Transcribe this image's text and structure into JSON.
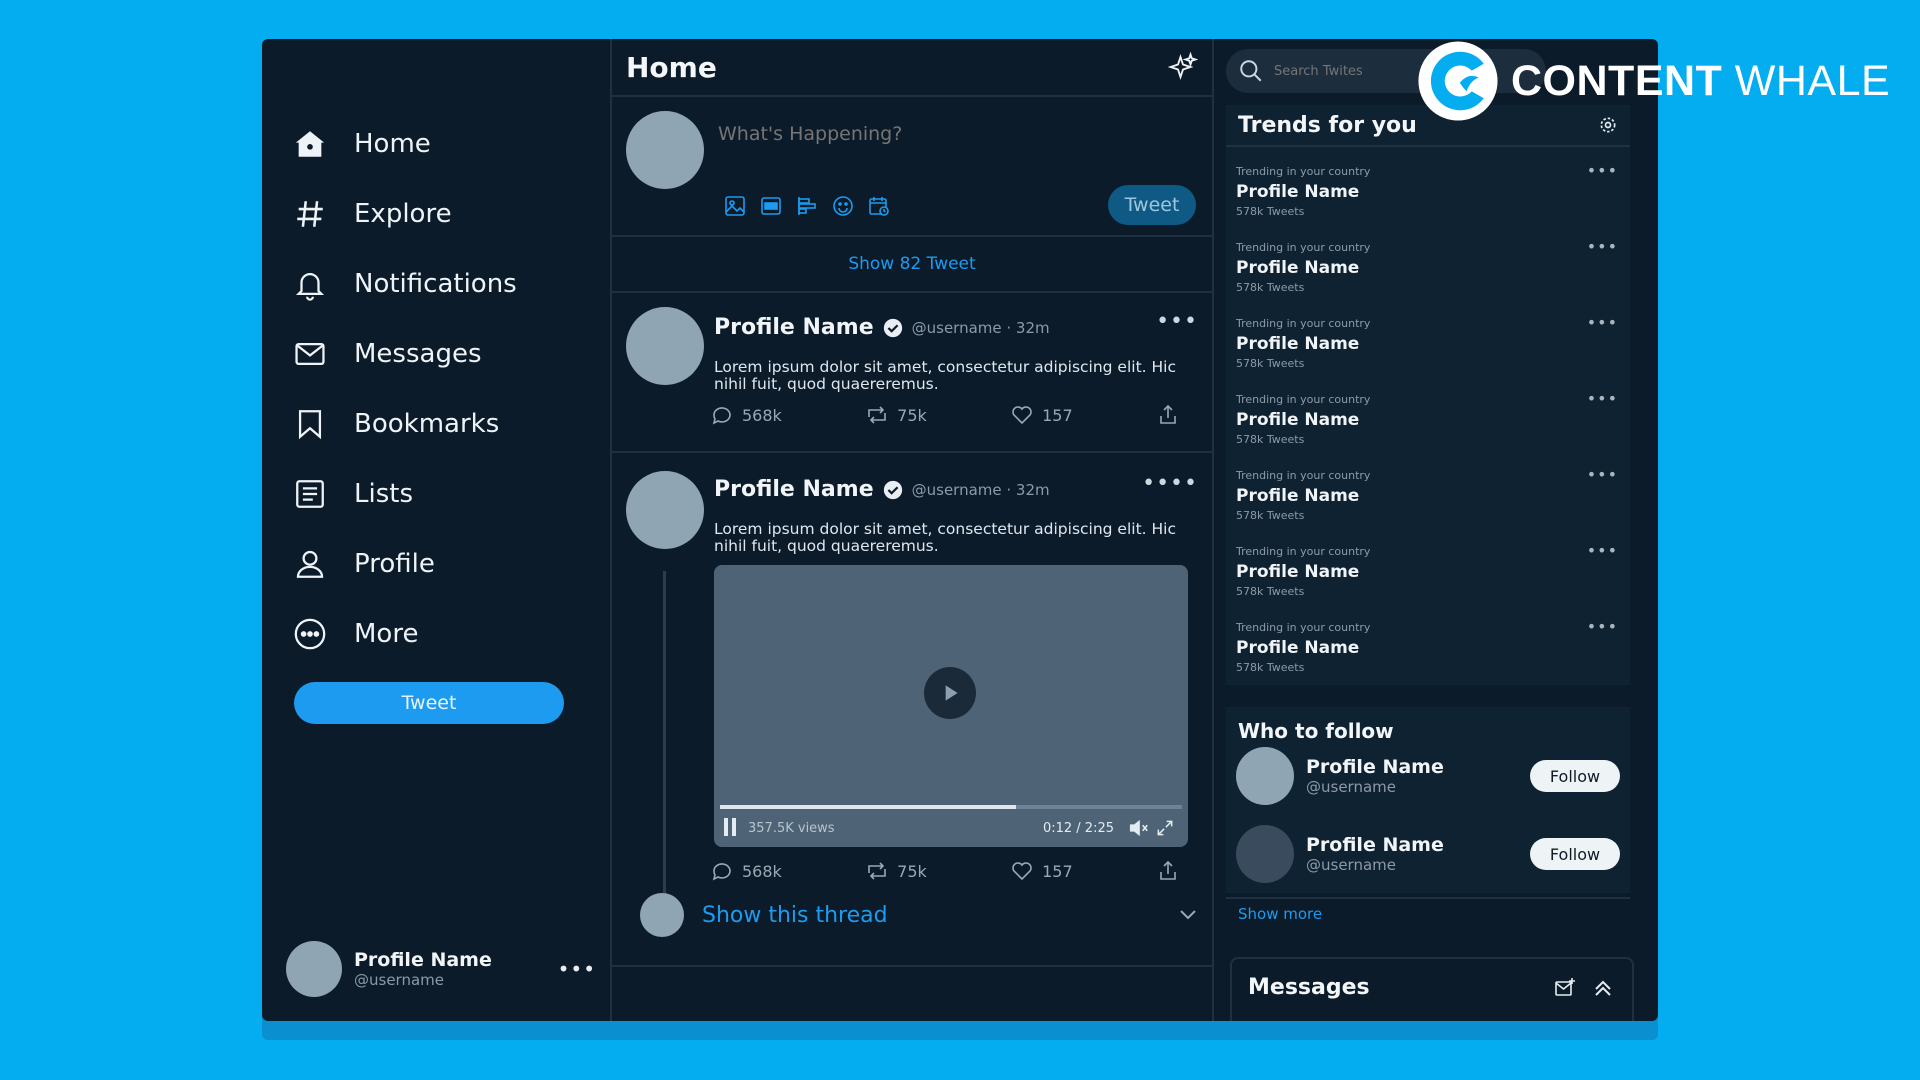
{
  "brand": {
    "name_bold": "CONTENT",
    "name_light": "WHALE"
  },
  "sidebar": {
    "items": [
      {
        "label": "Home",
        "icon": "home-icon"
      },
      {
        "label": "Explore",
        "icon": "hash-icon"
      },
      {
        "label": "Notifications",
        "icon": "bell-icon"
      },
      {
        "label": "Messages",
        "icon": "mail-icon"
      },
      {
        "label": "Bookmarks",
        "icon": "bookmark-icon"
      },
      {
        "label": "Lists",
        "icon": "list-icon"
      },
      {
        "label": "Profile",
        "icon": "user-icon"
      },
      {
        "label": "More",
        "icon": "more-circle-icon"
      }
    ],
    "tweet_button": "Tweet",
    "account": {
      "name": "Profile Name",
      "username": "@username"
    }
  },
  "feed": {
    "title": "Home",
    "compose": {
      "placeholder": "What's Happening?",
      "button": "Tweet"
    },
    "show_new": "Show 82 Tweet",
    "tweets": [
      {
        "name": "Profile Name",
        "meta": "@username · 32m",
        "text": "Lorem ipsum dolor sit amet, consectetur adipiscing elit. Hic nihil fuit, quod quaereremus.",
        "replies": "568k",
        "retweets": "75k",
        "likes": "157"
      },
      {
        "name": "Profile Name",
        "meta": "@username · 32m",
        "text": "Lorem ipsum dolor sit amet, consectetur adipiscing elit. Hic nihil fuit, quod quaereremus.",
        "replies": "568k",
        "retweets": "75k",
        "likes": "157",
        "video": {
          "views": "357.5K views",
          "time": "0:12 / 2:25",
          "progress": 0.64
        },
        "show_thread": "Show this thread"
      }
    ]
  },
  "right": {
    "search_placeholder": "Search Twites",
    "trends_title": "Trends for you",
    "trends": [
      {
        "category": "Trending in your country",
        "name": "Profile Name",
        "count": "578k Tweets"
      },
      {
        "category": "Trending in your country",
        "name": "Profile Name",
        "count": "578k Tweets"
      },
      {
        "category": "Trending in your country",
        "name": "Profile Name",
        "count": "578k Tweets"
      },
      {
        "category": "Trending in your country",
        "name": "Profile Name",
        "count": "578k Tweets"
      },
      {
        "category": "Trending in your country",
        "name": "Profile Name",
        "count": "578k Tweets"
      },
      {
        "category": "Trending in your country",
        "name": "Profile Name",
        "count": "578k Tweets"
      },
      {
        "category": "Trending in your country",
        "name": "Profile Name",
        "count": "578k Tweets"
      }
    ],
    "who_to_follow": {
      "title": "Who to follow",
      "people": [
        {
          "name": "Profile Name",
          "username": "@username",
          "button": "Follow"
        },
        {
          "name": "Profile Name",
          "username": "@username",
          "button": "Follow"
        }
      ],
      "show_more": "Show more"
    },
    "messages_title": "Messages"
  },
  "colors": {
    "accent": "#1d9bf0",
    "background": "#04adef",
    "panel": "#0c1b2a"
  }
}
